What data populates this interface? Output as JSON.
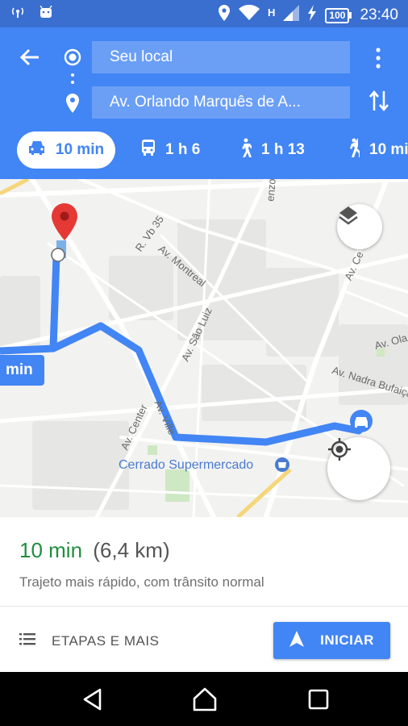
{
  "status_bar": {
    "network": "H",
    "battery": "100",
    "time": "23:40",
    "icons": [
      "signal-icon",
      "android-icon",
      "location-icon",
      "wifi-icon",
      "cell-signal-icon",
      "charging-icon",
      "battery-icon"
    ]
  },
  "header": {
    "origin": "Seu local",
    "destination": "Av. Orlando Marquês de A...",
    "modes": [
      {
        "icon": "car-icon",
        "label": "10 min",
        "selected": true
      },
      {
        "icon": "bus-icon",
        "label": "1 h 6",
        "selected": false
      },
      {
        "icon": "walk-icon",
        "label": "1 h 13",
        "selected": false
      },
      {
        "icon": "rideshare-icon",
        "label": "10 mi",
        "selected": false
      }
    ]
  },
  "map": {
    "route_label": "min",
    "poi": "Cerrado Supermercado",
    "streets": [
      "R. Vb 35",
      "Av. Montreal",
      "Av. São Luiz",
      "Av. Center",
      "Av. Ville",
      "Av. Ce",
      "Av. Ola",
      "Av. Nadra Bufaiça",
      "enzo"
    ]
  },
  "route": {
    "duration": "10 min",
    "distance": "(6,4 km)",
    "description": "Trajeto mais rápido, com trânsito normal"
  },
  "actions": {
    "steps_label": "ETAPAS E MAIS",
    "start_label": "INICIAR"
  },
  "colors": {
    "header": "#4285f4",
    "route": "#4285f4",
    "duration": "#1e8e3e",
    "pin": "#e53935"
  }
}
